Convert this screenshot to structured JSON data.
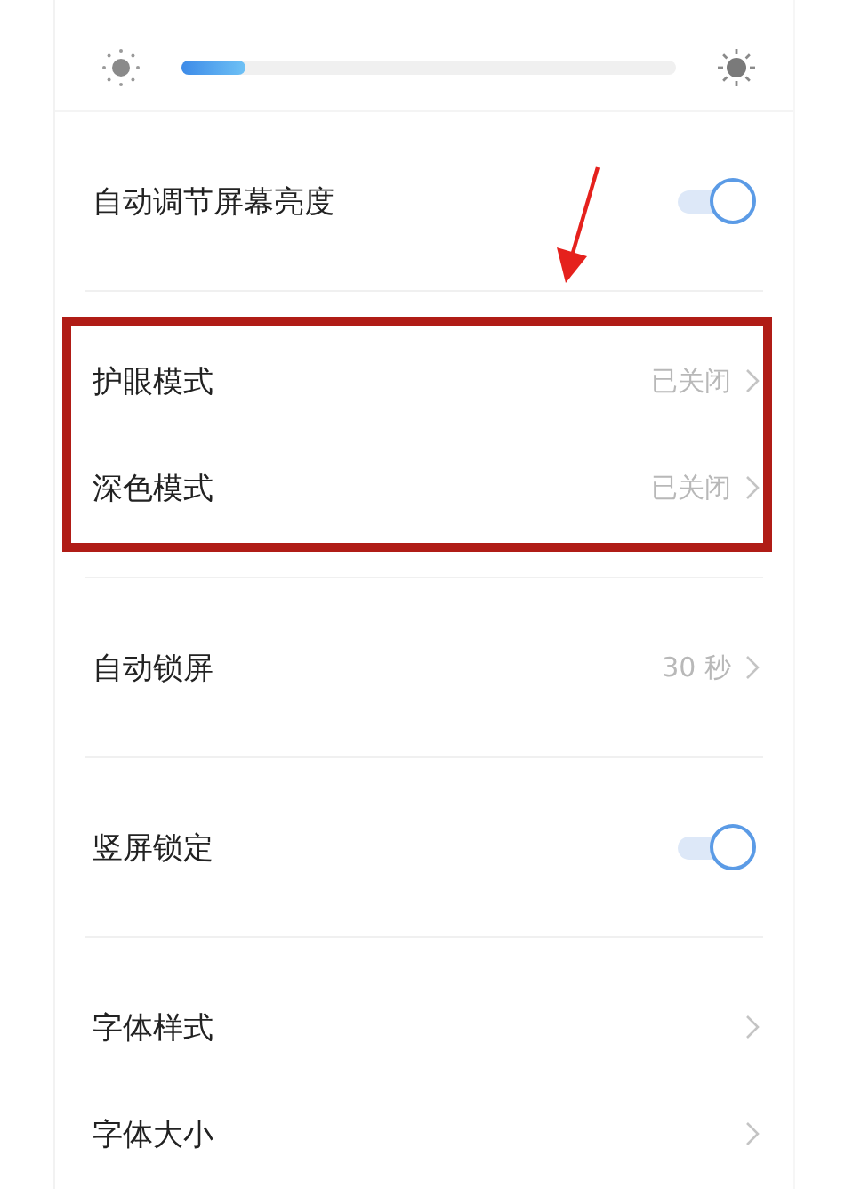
{
  "brightness": {
    "level": 0.13
  },
  "groups": [
    {
      "highlighted": false,
      "rows": [
        {
          "kind": "toggle",
          "label": "自动调节屏幕亮度",
          "on": true
        }
      ]
    },
    {
      "highlighted": true,
      "rows": [
        {
          "kind": "link",
          "label": "护眼模式",
          "value": "已关闭"
        },
        {
          "kind": "link",
          "label": "深色模式",
          "value": "已关闭"
        }
      ]
    },
    {
      "highlighted": false,
      "rows": [
        {
          "kind": "link",
          "label": "自动锁屏",
          "value": "30 秒"
        }
      ]
    },
    {
      "highlighted": false,
      "rows": [
        {
          "kind": "toggle",
          "label": "竖屏锁定",
          "on": true
        }
      ]
    },
    {
      "highlighted": false,
      "rows": [
        {
          "kind": "link",
          "label": "字体样式"
        },
        {
          "kind": "link",
          "label": "字体大小"
        }
      ]
    }
  ]
}
